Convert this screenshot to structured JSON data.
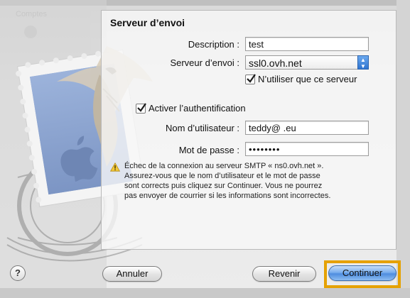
{
  "background": {
    "sidebar_label": "Comptes"
  },
  "dialog": {
    "title": "Serveur d’envoi",
    "description": {
      "label": "Description :",
      "value": "test"
    },
    "outgoing_server": {
      "label": "Serveur d’envoi :",
      "value": "ssl0.ovh.net"
    },
    "only_this_server": {
      "label": "N’utiliser que ce serveur",
      "checked": true
    },
    "use_auth": {
      "label": "Activer l’authentification",
      "checked": true
    },
    "username": {
      "label": "Nom d’utilisateur :",
      "value": "teddy@           .eu"
    },
    "password": {
      "label": "Mot de passe :",
      "value": "••••••••"
    },
    "warning": {
      "lines": [
        "Échec de la connexion au serveur SMTP « ns0.ovh.net ».",
        "Assurez-vous que le nom d’utilisateur et le mot de passe",
        "sont corrects puis cliquez sur Continuer. Vous ne pourrez",
        "pas envoyer de courrier si les informations sont incorrectes."
      ]
    }
  },
  "footer": {
    "help": "?",
    "cancel": "Annuler",
    "back": "Revenir",
    "continue": "Continuer"
  },
  "colors": {
    "accent": "#4f8ddf",
    "focus_ring": "#e5a100"
  }
}
